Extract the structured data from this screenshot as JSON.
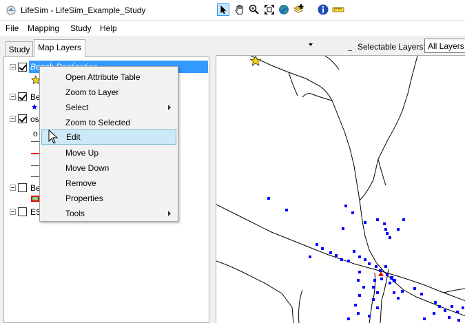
{
  "window": {
    "title": "LifeSim - LifeSim_Example_Study",
    "icon": "app-icon"
  },
  "menu": [
    "File",
    "Mapping",
    "Study",
    "Help"
  ],
  "tabs": [
    {
      "label": "Study",
      "active": false
    },
    {
      "label": "Map Layers",
      "active": true
    }
  ],
  "layers": [
    {
      "label": "Bench Destination",
      "checked": true,
      "selected": true,
      "symbol": "star-icon"
    },
    {
      "label": "Be",
      "checked": true,
      "selected": false,
      "symbol": "point-icon"
    },
    {
      "label": "os",
      "checked": true,
      "selected": false,
      "symbol": "line-icon"
    },
    {
      "label": "Be",
      "checked": false,
      "selected": false,
      "symbol": "polygon-icon"
    },
    {
      "label": "ES",
      "checked": false,
      "selected": false,
      "symbol": ""
    }
  ],
  "legend_fragments": [
    "o"
  ],
  "toolbar": {
    "tools": [
      "select-arrow-icon",
      "pan-hand-icon",
      "zoom-in-icon",
      "full-extent-icon",
      "globe-icon",
      "add-layer-icon",
      "dropdown-icon",
      "identify-icon",
      "measure-icon"
    ],
    "selectable_label": "Selectable Layers:",
    "selectable_value": "All Layers"
  },
  "context_menu": {
    "items": [
      {
        "label": "Open Attribute Table",
        "submenu": false,
        "hover": false
      },
      {
        "label": "Zoom to Layer",
        "submenu": false,
        "hover": false
      },
      {
        "label": "Select",
        "submenu": true,
        "hover": false
      },
      {
        "label": "Zoom to Selected",
        "submenu": false,
        "hover": false
      },
      {
        "label": "Edit",
        "submenu": false,
        "hover": true
      },
      {
        "label": "Move Up",
        "submenu": false,
        "hover": false
      },
      {
        "label": "Move Down",
        "submenu": false,
        "hover": false
      },
      {
        "label": "Remove",
        "submenu": false,
        "hover": false
      },
      {
        "label": "Properties",
        "submenu": false,
        "hover": false
      },
      {
        "label": "Tools",
        "submenu": true,
        "hover": false
      }
    ]
  },
  "colors": {
    "selection": "#3399ff",
    "menu_hover": "#cde8f6",
    "points": "#0000ff",
    "star": "#ffd700",
    "road": "#000000"
  }
}
